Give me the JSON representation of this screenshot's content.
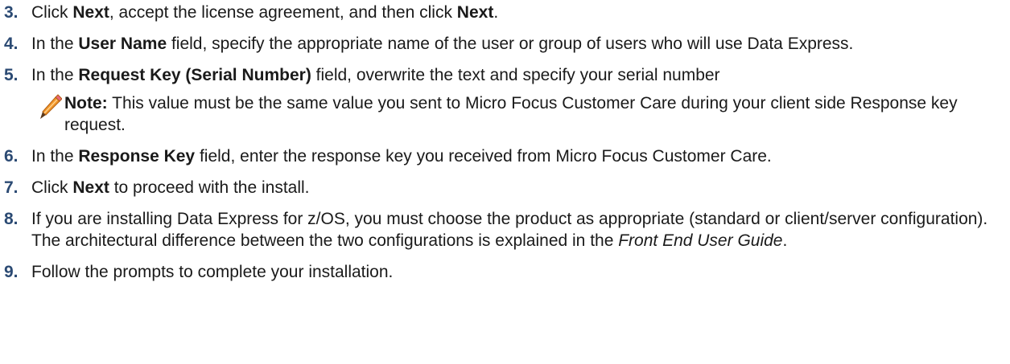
{
  "steps": [
    {
      "number": "3.",
      "parts": [
        "Click ",
        "Next",
        ", accept the license agreement, and then click ",
        "Next",
        "."
      ]
    },
    {
      "number": "4.",
      "parts": [
        "In the ",
        "User Name",
        " field, specify the appropriate name of the user or group of users who will use Data Express."
      ]
    },
    {
      "number": "5.",
      "parts": [
        "In the ",
        "Request Key (Serial Number)",
        " field, overwrite the text and specify your serial number"
      ]
    },
    {
      "number": "6.",
      "parts": [
        "In the ",
        "Response Key",
        " field, enter the response key you received from Micro Focus Customer Care."
      ]
    },
    {
      "number": "7.",
      "parts": [
        "Click ",
        "Next",
        " to proceed with the install."
      ]
    },
    {
      "number": "8.",
      "parts": [
        "If you are installing Data Express for z/OS, you must choose the product as appropriate (standard or client/server configuration). The architectural difference between the two configurations is explained in the ",
        "Front End User Guide",
        "."
      ]
    },
    {
      "number": "9.",
      "parts": [
        "Follow the prompts to complete your installation."
      ]
    }
  ],
  "note": {
    "label": "Note:",
    "text": " This value must be the same value you sent to Micro Focus Customer Care during your client side Response key request."
  },
  "icons": {
    "note": "pencil-icon"
  },
  "colors": {
    "text": "#1a1a1a",
    "step_number": "#2b4a73",
    "pencil_body": "#f0962a"
  }
}
